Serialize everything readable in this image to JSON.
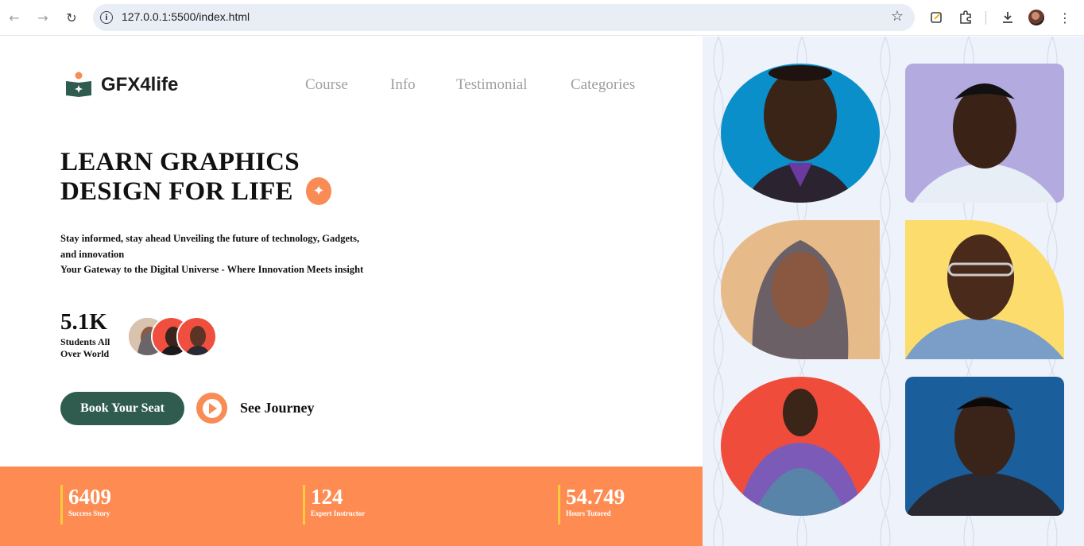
{
  "browser": {
    "url": "127.0.0.1:5500/index.html",
    "icons": [
      "back-icon",
      "forward-icon",
      "reload-icon",
      "info-icon",
      "bookmark-star-icon",
      "notes-icon",
      "extensions-icon",
      "download-icon",
      "profile-avatar",
      "menu-icon"
    ]
  },
  "site": {
    "brand": "GFX4life",
    "nav": [
      "Course",
      "Info",
      "Testimonial",
      "Categories"
    ]
  },
  "hero": {
    "title_line1": "LEARN GRAPHICS",
    "title_line2": "DESIGN FOR LIFE",
    "tagline_line1": "Stay informed, stay ahead Unveiling the future of technology, Gadgets,",
    "tagline_line2": "and innovation",
    "tagline_line3": "Your Gateway to the Digital Universe - Where Innovation Meets insight"
  },
  "students": {
    "count": "5.1K",
    "label_line1": "Students All",
    "label_line2": "Over World"
  },
  "cta": {
    "book_label": "Book Your Seat",
    "journey_label": "See Journey"
  },
  "stats": [
    {
      "value": "6409",
      "label": "Success Story"
    },
    {
      "value": "124",
      "label": "Expert Instructor"
    },
    {
      "value": "54.749",
      "label": "Hours Tutored"
    }
  ],
  "colors": {
    "accent_orange": "#fe8c52",
    "button_green": "#2f5c4f",
    "stat_bar_yellow": "#ffcb3d"
  }
}
